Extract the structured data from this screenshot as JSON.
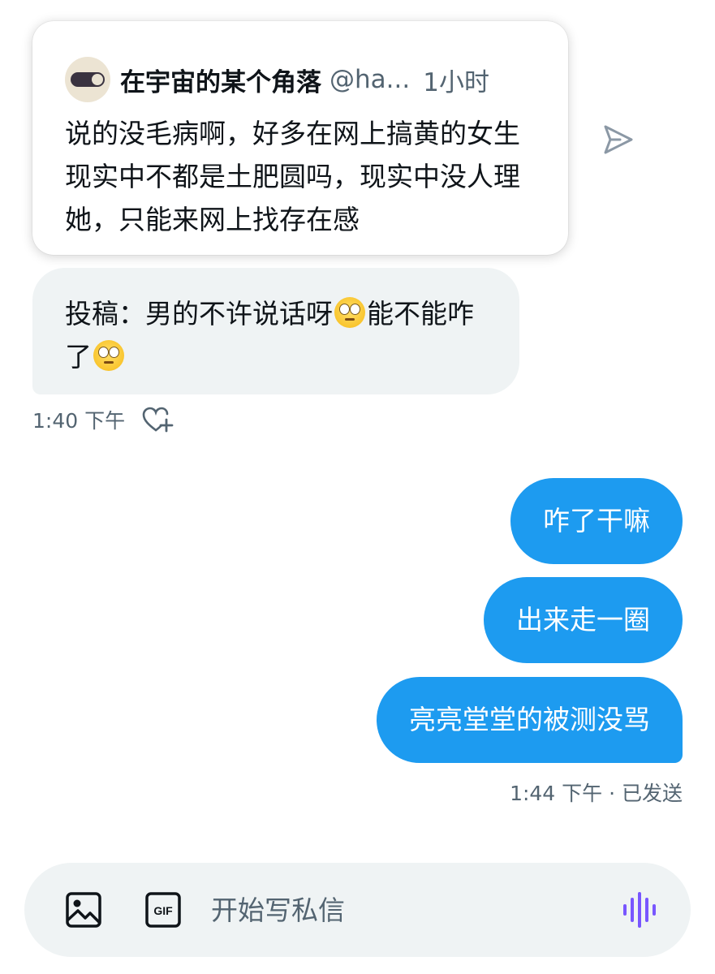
{
  "quote": {
    "author_name": "在宇宙的某个角落",
    "author_handle": "@ha...",
    "time": "1小时",
    "text": "说的没毛病啊，好多在网上搞黄的女生现实中不都是土肥圆吗，现实中没人理她，只能来网上找存在感"
  },
  "received": {
    "text_part1": "投稿：男的不许说话呀",
    "emoji_1": "face-with-rolling-eyes",
    "text_part2": "能不能咋了",
    "emoji_2": "face-with-rolling-eyes",
    "time": "1:40 下午"
  },
  "sent": {
    "messages": [
      "咋了干嘛",
      "出来走一圈",
      "亮亮堂堂的被测没骂"
    ],
    "status": "1:44 下午 · 已发送"
  },
  "composer": {
    "placeholder": "开始写私信",
    "gif_label": "GIF"
  },
  "colors": {
    "accent": "#1d9bf0",
    "bubble_received": "#eff3f4",
    "secondary_text": "#536471",
    "voice_icon": "#7856ff"
  }
}
